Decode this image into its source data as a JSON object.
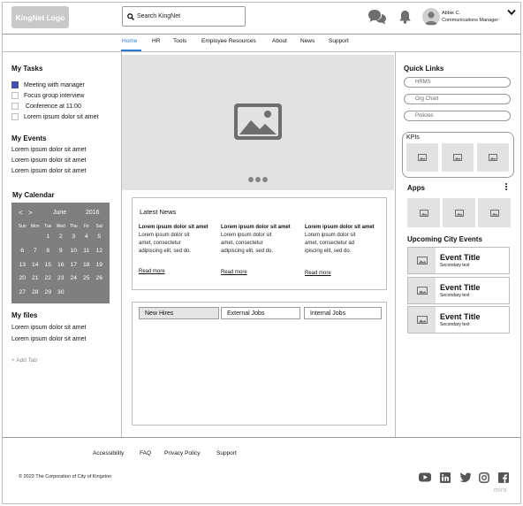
{
  "header": {
    "logo_text": "KingNet Logo",
    "search_placeholder": "Search KingNet",
    "user_name": "Abbie C.",
    "user_role": "Communications Manager"
  },
  "nav": {
    "items": [
      "Home",
      "HR",
      "Tools",
      "Employee Resources",
      "About",
      "News",
      "Support"
    ],
    "active": "Home"
  },
  "left": {
    "tasks_title": "My Tasks",
    "tasks": [
      {
        "label": "Meeting with manager",
        "checked": true
      },
      {
        "label": "Focus group interview",
        "checked": false
      },
      {
        "label": " Conference at 11:00",
        "checked": false
      },
      {
        "label": "Lorem ipsum dolor sit amet",
        "checked": false
      }
    ],
    "events_title": "My Events",
    "events": [
      "Lorem ipsum dolor sit amet",
      "Lorem ipsum dolor sit amet",
      "Lorem ipsum dolor sit amet"
    ],
    "calendar_title": "My Calendar",
    "calendar": {
      "prev": "<",
      "next": ">",
      "month": "June",
      "year": "2016",
      "weekdays": [
        "Sun",
        "Mon",
        "Tue",
        "Wed",
        "Thu",
        "Fri",
        "Sat"
      ],
      "weeks": [
        [
          "",
          "",
          "1",
          "2",
          "3",
          "4",
          "5"
        ],
        [
          "6",
          "7",
          "8",
          "9",
          "10",
          "11",
          "12"
        ],
        [
          "13",
          "14",
          "15",
          "16",
          "17",
          "18",
          "19"
        ],
        [
          "20",
          "21",
          "22",
          "23",
          "24",
          "25",
          "26"
        ],
        [
          "27",
          "28",
          "29",
          "30",
          "",
          "",
          ""
        ]
      ]
    },
    "files_title": "My files",
    "files": [
      "Lorem ipsum dolor sit amet",
      "Lorem ipsum dolor sit amet"
    ],
    "add_tab": "+ Add Tab"
  },
  "main": {
    "news_title": "Latest News",
    "news": [
      {
        "headline": "Lorem ipsum dolor sit amet",
        "body": "Lorem ipsum dolor sit amet, consectetur adipiscing elit, sed do.",
        "more": "Read more"
      },
      {
        "headline": "Lorem ipsum dolor sit amet",
        "body": "Lorem ipsum dolor sit amet, consectetur adipiscing elit, sed do.",
        "more": "Read more"
      },
      {
        "headline": "Lorem ipsum dolor sit amet",
        "body": "Lorem ipsum dolor sit amet, consectetur ad ipiscing elit, sed do.",
        "more": "Read more"
      }
    ],
    "job_tabs": [
      "New Hires",
      "External Jobs",
      "Internal Jobs"
    ],
    "job_tab_active": "New Hires"
  },
  "right": {
    "quick_links_title": "Quick Links",
    "quick_links": [
      "HRMS",
      "Org Chart",
      "Policies"
    ],
    "kpis_title": "KPIs",
    "apps_title": "Apps",
    "upcoming_title": "Upcoming City Events",
    "upcoming": [
      {
        "title": "Event Title",
        "subtitle": "Secondary text"
      },
      {
        "title": "Event Title",
        "subtitle": "Secondary text"
      },
      {
        "title": "Event Title",
        "subtitle": "Secondary text"
      }
    ]
  },
  "footer": {
    "links": [
      "Accessibility",
      "FAQ",
      "Privacy Policy",
      "Support"
    ],
    "copyright": "© 2023 The Corporation of City of Kingston",
    "social_icons": [
      "youtube-icon",
      "linkedin-icon",
      "twitter-icon",
      "instagram-icon",
      "facebook-icon"
    ],
    "watermark": "miro"
  },
  "colors": {
    "accent": "#2e7ad3",
    "checkbox": "#444fa8",
    "calendar_bg": "#7f7f7f",
    "placeholder_gray": "#e2e2e2"
  }
}
